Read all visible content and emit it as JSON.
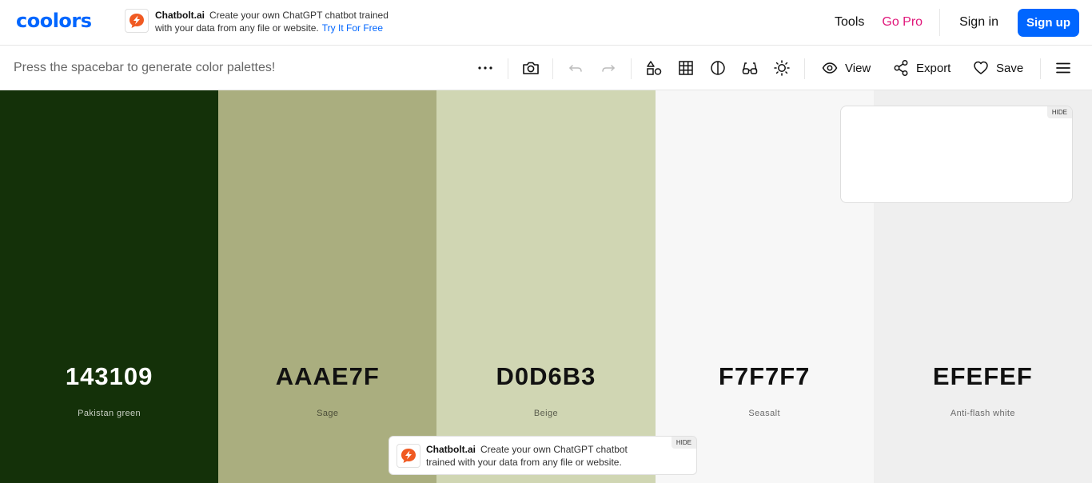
{
  "brand": {
    "logo": "coolors",
    "accent": "#0066ff"
  },
  "top_ad": {
    "brand": "Chatbolt.ai",
    "text_line1": "Create your own ChatGPT chatbot trained",
    "text_line2": "with your data from any file or website.",
    "cta": "Try It For Free",
    "icon": "chatbolt-logo-icon"
  },
  "nav": {
    "tools": "Tools",
    "go_pro": "Go Pro",
    "sign_in": "Sign in",
    "sign_up": "Sign up"
  },
  "toolbar": {
    "hint": "Press the spacebar to generate color palettes!",
    "view": "View",
    "export": "Export",
    "save": "Save",
    "icons": [
      "more-icon",
      "camera-icon",
      "undo-icon",
      "redo-icon",
      "shapes-icon",
      "grid-icon",
      "contrast-icon",
      "glasses-icon",
      "sun-icon",
      "eye-icon",
      "share-icon",
      "heart-icon",
      "menu-icon"
    ]
  },
  "palette": [
    {
      "hex": "143109",
      "name": "Pakistan green",
      "color": "#143109",
      "text_color": "#ffffff",
      "name_color": "#c8cfc4"
    },
    {
      "hex": "AAAE7F",
      "name": "Sage",
      "color": "#aaae7f",
      "text_color": "#111111",
      "name_color": "#4a4c38"
    },
    {
      "hex": "D0D6B3",
      "name": "Beige",
      "color": "#d0d6b3",
      "text_color": "#111111",
      "name_color": "#5a5d4e"
    },
    {
      "hex": "F7F7F7",
      "name": "Seasalt",
      "color": "#f7f7f7",
      "text_color": "#111111",
      "name_color": "#6b6b6b"
    },
    {
      "hex": "EFEFEF",
      "name": "Anti-flash white",
      "color": "#efefef",
      "text_color": "#111111",
      "name_color": "#686868"
    }
  ],
  "side_ad": {
    "hide": "HIDE"
  },
  "bottom_ad": {
    "brand": "Chatbolt.ai",
    "text_line1": "Create your own ChatGPT chatbot",
    "text_line2": "trained with your data from any file or website.",
    "hide": "HIDE",
    "icon": "chatbolt-logo-icon"
  }
}
